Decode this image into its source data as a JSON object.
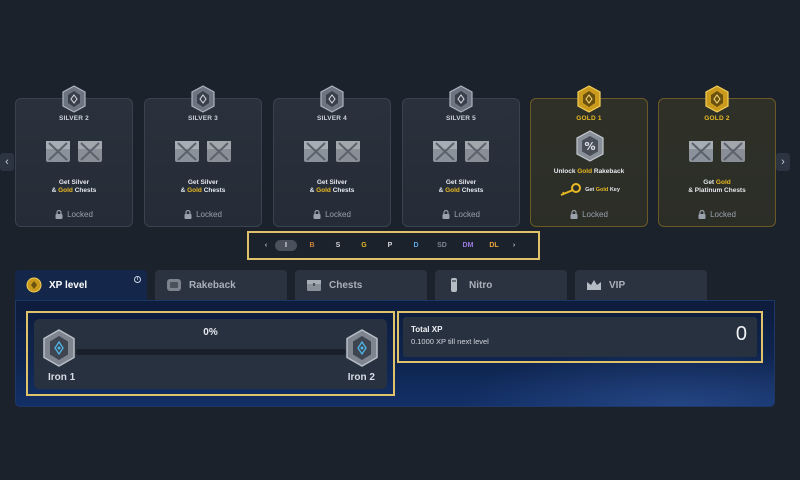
{
  "nav": {
    "prev_symbol": "‹",
    "next_symbol": "›"
  },
  "cards": [
    {
      "title": "SILVER 2",
      "line1": "Get Silver",
      "line2_pre": "& ",
      "line2_gold": "Gold",
      "line2_post": " Chests",
      "status": "Locked"
    },
    {
      "title": "SILVER 3",
      "line1": "Get Silver",
      "line2_pre": "& ",
      "line2_gold": "Gold",
      "line2_post": " Chests",
      "status": "Locked"
    },
    {
      "title": "SILVER 4",
      "line1": "Get Silver",
      "line2_pre": "& ",
      "line2_gold": "Gold",
      "line2_post": " Chests",
      "status": "Locked"
    },
    {
      "title": "SILVER 5",
      "line1": "Get Silver",
      "line2_pre": "& ",
      "line2_gold": "Gold",
      "line2_post": " Chests",
      "status": "Locked"
    },
    {
      "title": "GOLD 1",
      "unlock_pre": "Unlock ",
      "unlock_gold": "Gold",
      "unlock_post": " Rakeback",
      "key_pre": "Get ",
      "key_gold": "Gold",
      "key_post": " Key",
      "status": "Locked"
    },
    {
      "title": "GOLD 2",
      "line1_pre": "Get ",
      "line1_gold": "Gold",
      "line2": "& Platinum Chests",
      "status": "Locked"
    }
  ],
  "pager": {
    "prev": "‹",
    "next": "›",
    "items": [
      {
        "label": "I",
        "color": "#e8ebef"
      },
      {
        "label": "B",
        "color": "#c9813c"
      },
      {
        "label": "S",
        "color": "#d4d8de"
      },
      {
        "label": "G",
        "color": "#e8b923"
      },
      {
        "label": "P",
        "color": "#d4d8de"
      },
      {
        "label": "D",
        "color": "#5aa7e0"
      },
      {
        "label": "SD",
        "color": "#7b8494"
      },
      {
        "label": "DM",
        "color": "#9b7be0"
      },
      {
        "label": "DL",
        "color": "#e8a43a"
      }
    ]
  },
  "tabs": [
    {
      "label": "XP level",
      "icon": "xp-medal-icon"
    },
    {
      "label": "Rakeback",
      "icon": "rakeback-icon"
    },
    {
      "label": "Chests",
      "icon": "chest-icon"
    },
    {
      "label": "Nitro",
      "icon": "nitro-icon"
    },
    {
      "label": "VIP",
      "icon": "crown-icon"
    }
  ],
  "tab_info": "i",
  "level": {
    "progress_label": "0%",
    "progress": 0,
    "current_rank": "Iron 1",
    "next_rank": "Iron 2"
  },
  "xp": {
    "title": "Total XP",
    "subtitle": "0.1000 XP till next level",
    "value": "0"
  },
  "colors": {
    "gold": "#e8b923",
    "highlight_border": "#e0c26a",
    "panel_blue": "#0f2550"
  }
}
